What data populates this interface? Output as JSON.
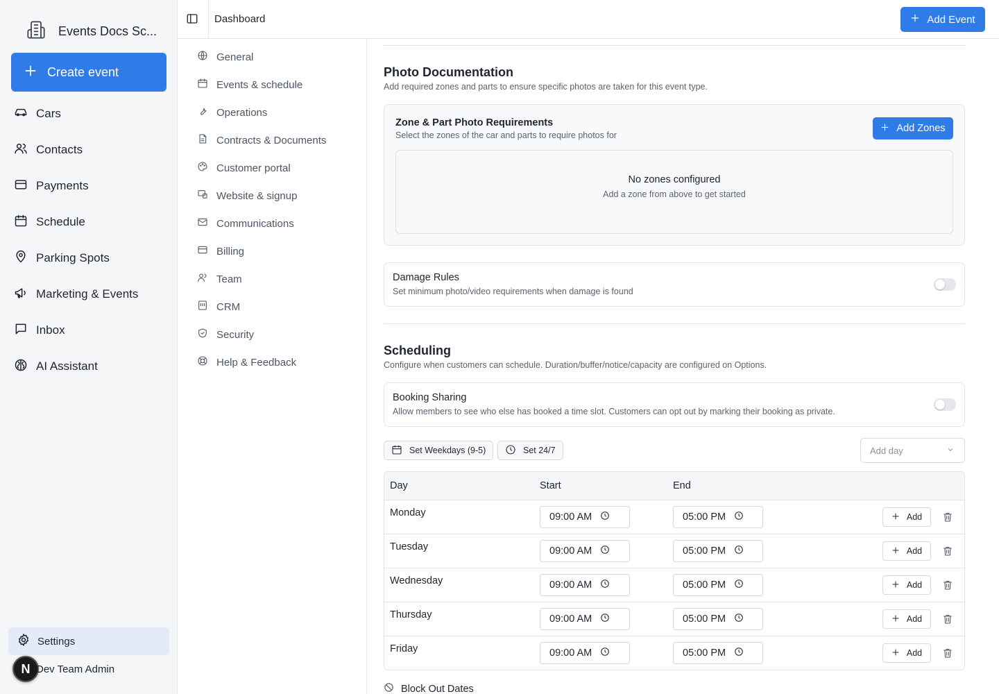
{
  "app": {
    "name": "Events Docs Sc...",
    "create_label": "Create event",
    "nav": [
      {
        "label": "Cars",
        "icon": "car-icon"
      },
      {
        "label": "Contacts",
        "icon": "users-icon"
      },
      {
        "label": "Payments",
        "icon": "credit-card-icon"
      },
      {
        "label": "Schedule",
        "icon": "calendar-icon"
      },
      {
        "label": "Parking Spots",
        "icon": "map-pin-icon"
      },
      {
        "label": "Marketing & Events",
        "icon": "megaphone-icon"
      },
      {
        "label": "Inbox",
        "icon": "message-icon"
      },
      {
        "label": "AI Assistant",
        "icon": "brain-icon"
      }
    ],
    "settings_label": "Settings",
    "user": {
      "initial": "N",
      "name": "Dev Team Admin"
    }
  },
  "header": {
    "breadcrumb": "Dashboard",
    "add_event_label": "Add Event"
  },
  "settings_nav": [
    {
      "label": "General",
      "icon": "globe-icon"
    },
    {
      "label": "Events & schedule",
      "icon": "calendar-icon"
    },
    {
      "label": "Operations",
      "icon": "wrench-icon"
    },
    {
      "label": "Contracts & Documents",
      "icon": "file-icon"
    },
    {
      "label": "Customer portal",
      "icon": "palette-icon"
    },
    {
      "label": "Website & signup",
      "icon": "website-icon"
    },
    {
      "label": "Communications",
      "icon": "mail-icon"
    },
    {
      "label": "Billing",
      "icon": "credit-card-icon"
    },
    {
      "label": "Team",
      "icon": "users-icon"
    },
    {
      "label": "CRM",
      "icon": "crm-icon"
    },
    {
      "label": "Security",
      "icon": "shield-icon"
    },
    {
      "label": "Help & Feedback",
      "icon": "lifebuoy-icon"
    }
  ],
  "photo_doc": {
    "title": "Photo Documentation",
    "description": "Add required zones and parts to ensure specific photos are taken for this event type.",
    "zone_card": {
      "title": "Zone & Part Photo Requirements",
      "description": "Select the zones of the car and parts to require photos for",
      "add_label": "Add Zones",
      "empty_title": "No zones configured",
      "empty_desc": "Add a zone from above to get started"
    },
    "damage_rules": {
      "title": "Damage Rules",
      "description": "Set minimum photo/video requirements when damage is found",
      "enabled": false
    }
  },
  "scheduling": {
    "title": "Scheduling",
    "description": "Configure when customers can schedule. Duration/buffer/notice/capacity are configured on Options.",
    "booking_sharing": {
      "title": "Booking Sharing",
      "description": "Allow members to see who else has booked a time slot. Customers can opt out by marking their booking as private.",
      "enabled": false
    },
    "preset_weekdays": "Set Weekdays (9-5)",
    "preset_247": "Set 24/7",
    "add_day_placeholder": "Add day",
    "columns": {
      "day": "Day",
      "start": "Start",
      "end": "End"
    },
    "add_label": "Add",
    "rows": [
      {
        "day": "Monday",
        "start": "09:00 AM",
        "end": "05:00 PM"
      },
      {
        "day": "Tuesday",
        "start": "09:00 AM",
        "end": "05:00 PM"
      },
      {
        "day": "Wednesday",
        "start": "09:00 AM",
        "end": "05:00 PM"
      },
      {
        "day": "Thursday",
        "start": "09:00 AM",
        "end": "05:00 PM"
      },
      {
        "day": "Friday",
        "start": "09:00 AM",
        "end": "05:00 PM"
      }
    ],
    "block_out_label": "Block Out Dates"
  },
  "colors": {
    "accent": "#2f7be8",
    "sidebar_bg": "#f5f6f8",
    "active_bg": "#e4eaf6"
  }
}
